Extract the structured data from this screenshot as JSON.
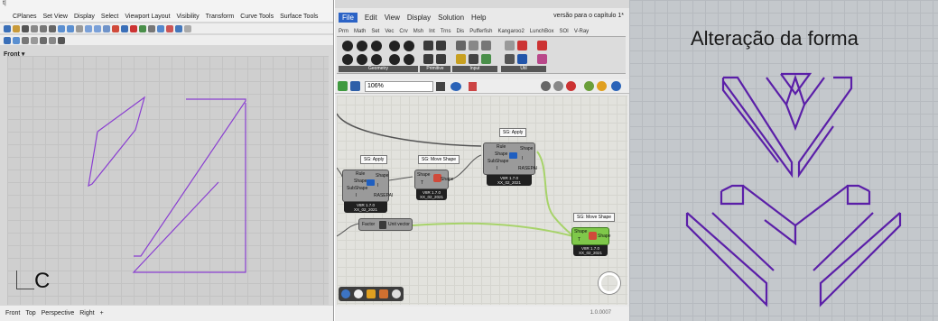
{
  "rhino": {
    "title": "t|",
    "menu": [
      "CPlanes",
      "Set View",
      "Display",
      "Select",
      "Viewport Layout",
      "Visibility",
      "Transform",
      "Curve Tools",
      "Surface Tools"
    ],
    "viewport_label": "Front",
    "corner_label": "C",
    "view_tabs": [
      "Front",
      "Top",
      "Perspective",
      "Right"
    ],
    "tab_add": "+",
    "curve_color": "#8a3fd1"
  },
  "gh": {
    "menu": [
      "File",
      "Edit",
      "View",
      "Display",
      "Solution",
      "Help"
    ],
    "document": "versão para o capítulo 1*",
    "tabs": [
      "Prm",
      "Math",
      "Set",
      "Vec",
      "Crv",
      "Msh",
      "Int",
      "Trns",
      "Dis",
      "Pufferfish",
      "Kangaroo2",
      "LunchBox",
      "SOI",
      "V-Ray"
    ],
    "panel_groups": [
      "Geometry",
      "Primitive",
      "Input",
      "Util"
    ],
    "zoom": "106%",
    "components": {
      "apply1": {
        "label": "SG: Apply",
        "ports": [
          "Rule",
          "Shape",
          "SubShape",
          "I"
        ],
        "out": [
          "Shape",
          "I",
          "RASEPAI"
        ],
        "cap": "V8R 1.7.0",
        "cap2": "XX_02_2021"
      },
      "move1": {
        "label": "SG: Move Shape",
        "ports": [
          "Shape",
          "T"
        ],
        "cap": "V8R 1.7.0",
        "cap2": "XX_02_2021"
      },
      "apply2": {
        "label": "SG: Apply",
        "ports": [
          "Rule",
          "Shape",
          "SubShape",
          "I"
        ],
        "out": [
          "Shape",
          "I",
          "RASEPAI"
        ],
        "cap": "V8R 1.7.0",
        "cap2": "XX_02_2021"
      },
      "vector": {
        "ports": [
          "Factor"
        ],
        "out": "Unit vector"
      },
      "move2": {
        "label": "SG: Move Shape",
        "ports": [
          "Shape",
          "T"
        ],
        "out": "Shape",
        "cap": "V8R 1.7.0",
        "cap2": "XX_02_2021"
      }
    },
    "status": "1.0.0007",
    "wire_color": "#a7d36a"
  },
  "shape_panel": {
    "title": "Alteração da forma",
    "curve_color": "#5b1fa8"
  }
}
